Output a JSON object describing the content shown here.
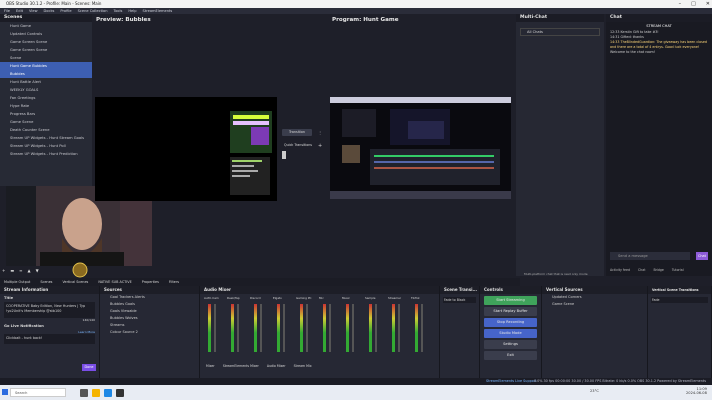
{
  "window": {
    "title": "OBS Studio 30.1.2 - Profile: Main - Scenes: Main"
  },
  "menu": [
    "File",
    "Edit",
    "View",
    "Docks",
    "Profile",
    "Scene Collection",
    "Tools",
    "Help",
    "StreamElements"
  ],
  "scenes": {
    "title": "Scenes",
    "items": [
      "Hunt Game",
      "Updated Controls",
      "Game Screen Scene",
      "Game Screen Scene",
      "Scene",
      "Hunt Game Bubbles",
      "Bubbles",
      "Hunt Battle Alert",
      "WEEKLY GOALS",
      "Fan Greetings",
      "Hype Rate",
      "Progress Bars",
      "Game Scene",
      "Death Counter Scene",
      "Stream UP Widgets - Hunt Stream Goals",
      "Stream UP Widgets - Hunt Poll",
      "Stream UP Widgets - Hunt Prediction"
    ],
    "selected": 6,
    "highlighted": 5
  },
  "preview": {
    "label": "Preview: Bubbles"
  },
  "program": {
    "label": "Program: Hunt Game"
  },
  "transition": {
    "button": "Transition",
    "quick": "Quick Transitions"
  },
  "multichat": {
    "title": "Multi-Chat",
    "select": "All Chats"
  },
  "chat": {
    "title": "Chat",
    "header": "STREAM CHAT",
    "msgs": [
      "12:33 Kerstin  Gift to take #3!",
      "14:31 Gifted: thanks",
      "14:33 TheBlindedGuardian: The giveaway has been closed and there are a total of 4 entrys. Good luck everyone!",
      "Welcome to the chat room!"
    ],
    "input_placeholder": "Send a message",
    "send": "Chat"
  },
  "chatTabs": [
    "Activity feed",
    "Chat",
    "Bridge",
    "Tutorial"
  ],
  "tabs": [
    "Multiple Output",
    "Scenes",
    "Vertical Scenes",
    "NATIVE SUB ACTIVE",
    "Properties",
    "Filters"
  ],
  "multichat_footer": "Multi-platform chat that is read only mode",
  "streamInfo": {
    "title": "Stream Information",
    "label_title": "Title",
    "title_value": "COOPERATIVE Baby Edition, New Hunters | Typ !yo2Unit's Membership @stb100",
    "count": "140/140",
    "gonline": "Go Live Notification",
    "learn": "Learn More",
    "notify": "Clickbait - hunt back!",
    "done": "Done"
  },
  "sources": {
    "title": "Sources",
    "items": [
      "Goal Trackers Alerts",
      "Bubbles Goals",
      "Goals Viewable",
      "Bubbles Wolves",
      "Streams",
      "Colour Source 2"
    ]
  },
  "audio": {
    "title": "Audio Mixer",
    "channels": [
      "Aufm Cam",
      "Desk/Tap",
      "Discord",
      "Elgato",
      "Gaming PC",
      "Mic",
      "Music",
      "Sample",
      "Streamer",
      "TikTok"
    ],
    "tabs": [
      "Mixer",
      "StreamElements Mixer",
      "Audio Mixer",
      "Stream Mix"
    ]
  },
  "sceneTransitions": {
    "title": "Scene Transi...",
    "value": "Fade to Black"
  },
  "controls": {
    "title": "Controls",
    "buttons": [
      "Start Streaming",
      "Start Replay Buffer",
      "Stop Recording",
      "Studio Mode",
      "Settings",
      "Exit"
    ],
    "footer": "StreamElements Live Support"
  },
  "verticalSources": {
    "title": "Vertical Sources",
    "items": [
      "Updated Corners",
      "Game Scene"
    ]
  },
  "verticalTransitions": {
    "title": "Vertical Scene Transitions",
    "value": "Fade"
  },
  "status": {
    "right": "0.0% 30 fps   00:00:00   30.00 / 30.00 FPS   Bitrate: 0 kb/s   0.0%  OBS 30.1.2 Powered by StreamElements"
  },
  "taskbar": {
    "search": "Search",
    "time": "11:09",
    "date": "2024-06-08",
    "temp": "23°C"
  }
}
